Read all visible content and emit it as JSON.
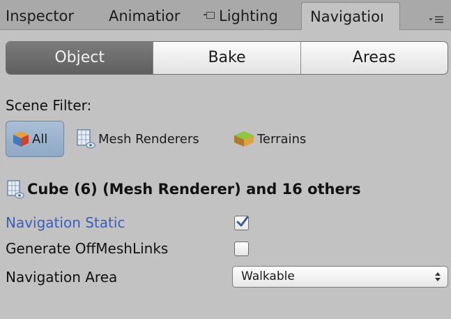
{
  "tabs": {
    "inspector": "Inspector",
    "animation": "Animatior",
    "lighting": "Lighting",
    "navigation": "Navigatioı",
    "menu_icon": "panel-menu-icon"
  },
  "segmented": {
    "object": "Object",
    "bake": "Bake",
    "areas": "Areas",
    "active": "Object"
  },
  "scene_filter": {
    "label": "Scene Filter:",
    "all": "All",
    "mesh_renderers": "Mesh Renderers",
    "terrains": "Terrains",
    "selected": "All"
  },
  "object": {
    "header": "Cube (6) (Mesh Renderer) and 16 others",
    "icon": "mesh-renderer-icon"
  },
  "properties": {
    "navigation_static_label": "Navigation Static",
    "navigation_static_checked": true,
    "generate_offmeshlinks_label": "Generate OffMeshLinks",
    "generate_offmeshlinks_checked": false,
    "navigation_area_label": "Navigation Area",
    "navigation_area_value": "Walkable"
  },
  "colors": {
    "background": "#c2c2c2",
    "tabstrip": "#a9a9a9",
    "active_segment": "#6b6b6b",
    "selected_filter": "#9db5cf",
    "blue_label": "#3a5ebd",
    "checkmark": "#3d5a99"
  }
}
